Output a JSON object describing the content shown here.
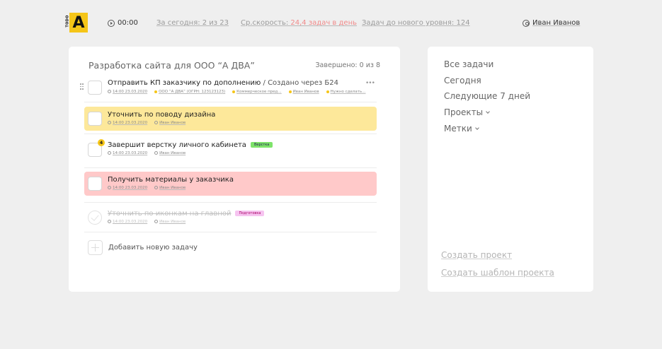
{
  "logo": {
    "letter": "A",
    "small_text": "TODO"
  },
  "header": {
    "timer": "00:00",
    "today": "За сегодня: 2 из 23",
    "speed_prefix": "Ср.скорость: ",
    "speed_value": "24,4 задач в день",
    "to_next_level": "Задач до нового уровня: 124",
    "user_name": "Иван Иванов"
  },
  "project": {
    "title": "Разработка сайта для ООО “А ДВА”",
    "completed": "Завершено: 0 из 8",
    "tasks": [
      {
        "name": "Отправить КП заказчику по дополнению",
        "sub": " / Создано через Б24",
        "date": "14:00 23.03.2020",
        "meta": [
          "ООО “А ДВА” (ОГРН: 123123123)",
          "Коммерческое пред...",
          "Иван Иванов",
          "Нужно сделать..."
        ]
      },
      {
        "name": "Уточнить по поводу дизайна",
        "date": "14:00 23.03.2020",
        "assignee": "Иван Иванов",
        "color": "#fde89a"
      },
      {
        "name": "Завершит верстку личного кабинета",
        "date": "14:00 23.03.2020",
        "assignee": "Иван Иванов",
        "tag": "Верстка",
        "badge": "4"
      },
      {
        "name": "Получить материалы у заказчика",
        "date": "14:00 23.03.2020",
        "assignee": "Иван Иванов",
        "color": "#ffc9c9"
      },
      {
        "name": "Уточнить по иконкам на главной",
        "date": "14:00 23.03.2020",
        "assignee": "Иван Иванов",
        "tag": "Подготовка",
        "done": true
      }
    ],
    "add_label": "Добавить новую задачу"
  },
  "sidebar": {
    "items": [
      "Все задачи",
      "Сегодня",
      "Следующие 7 дней",
      "Проекты",
      "Метки"
    ],
    "create_project": "Создать проект",
    "create_template": "Создать шаблон проекта"
  }
}
